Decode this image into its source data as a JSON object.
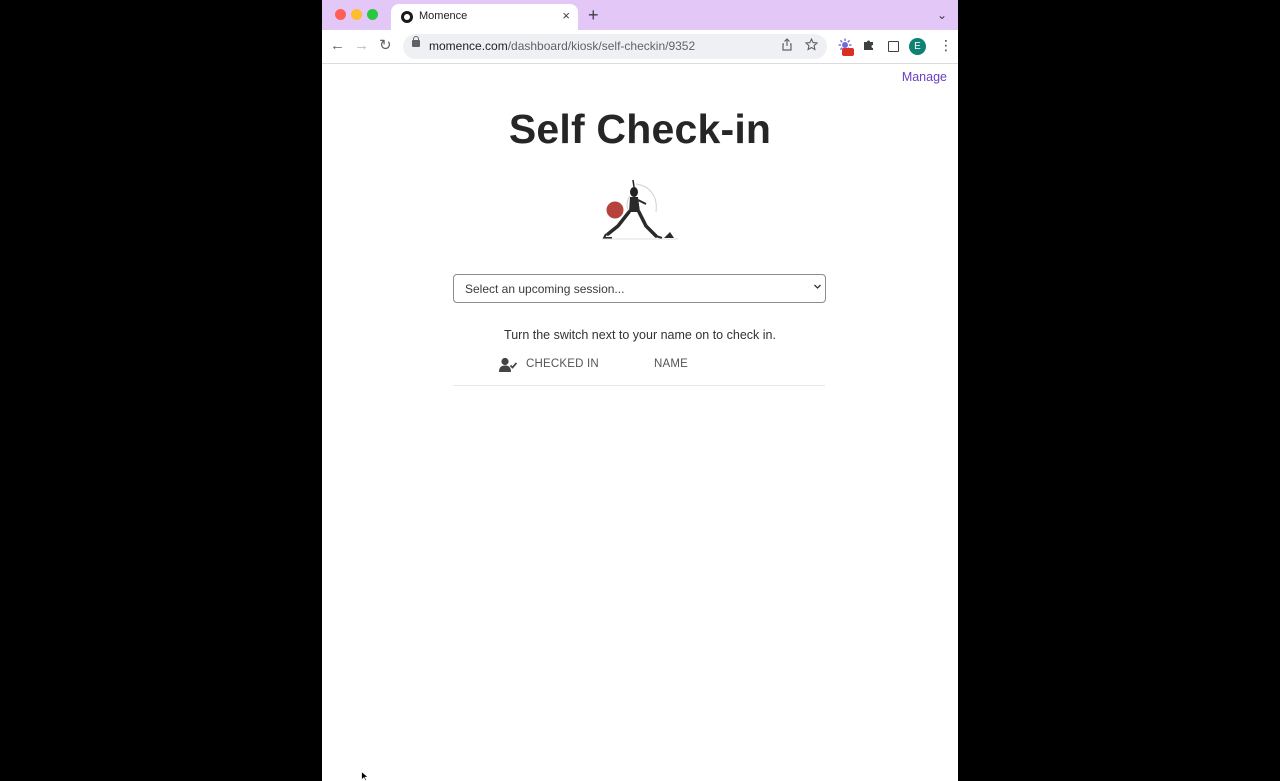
{
  "browser": {
    "tab": {
      "title": "Momence",
      "close_icon": "×"
    },
    "new_tab_icon": "+",
    "tab_list_icon": "⌄",
    "nav": {
      "back_icon": "←",
      "forward_icon": "→",
      "reload_icon": "↻"
    },
    "address": {
      "host": "momence.com",
      "path": "/dashboard/kiosk/self-checkin/9352"
    },
    "menu_icon": "⋮",
    "avatar_letter": "E"
  },
  "page": {
    "manage_link": "Manage",
    "title": "Self Check-in",
    "session_select": {
      "selected": "Select an upcoming session..."
    },
    "instructions": "Turn the switch next to your name on to check in.",
    "table": {
      "columns": [
        "CHECKED IN",
        "NAME"
      ]
    }
  },
  "colors": {
    "accent": "#6a3fc4",
    "tabstrip": "#e3c7f7",
    "ball": "#b5433b"
  }
}
